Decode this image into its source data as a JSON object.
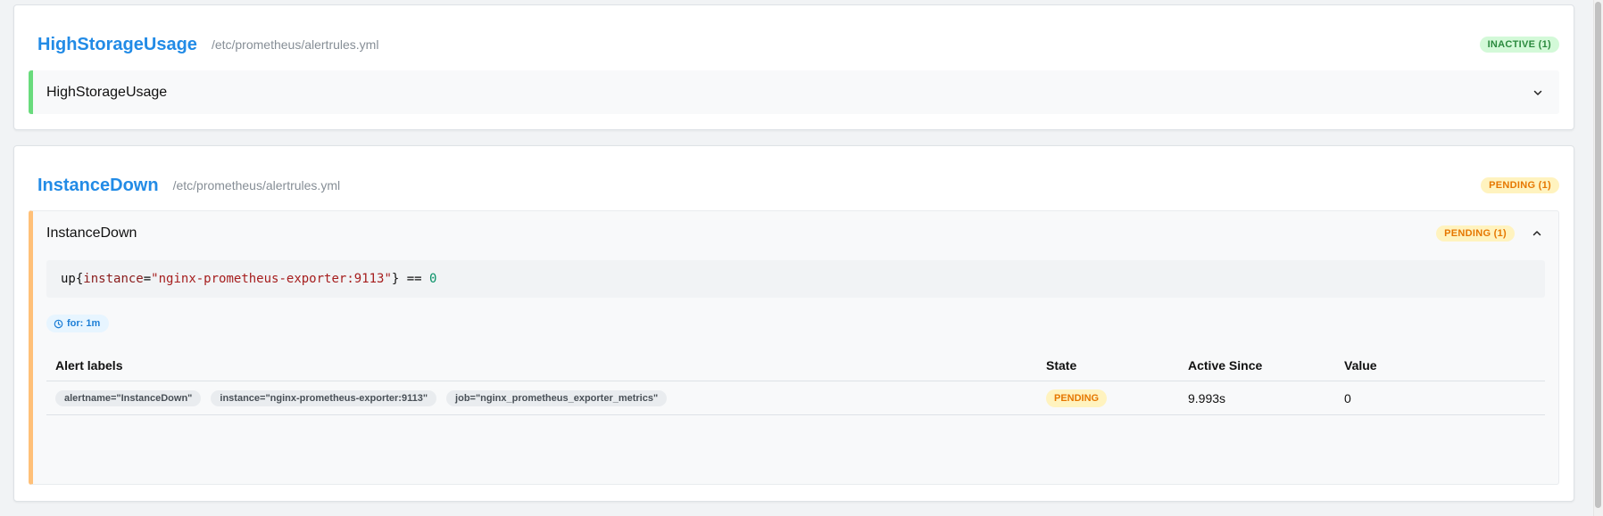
{
  "groups": [
    {
      "title": "HighStorageUsage",
      "file": "/etc/prometheus/alertrules.yml",
      "badge": "INACTIVE (1)",
      "rule_name": "HighStorageUsage"
    },
    {
      "title": "InstanceDown",
      "file": "/etc/prometheus/alertrules.yml",
      "badge": "PENDING (1)",
      "rule_name": "InstanceDown",
      "rule_badge": "PENDING (1)",
      "expr": {
        "metric": "up",
        "open": "{",
        "label": "instance",
        "eq": "=",
        "value": "\"nginx-prometheus-exporter:9113\"",
        "close": "}",
        "op": " == ",
        "num": "0"
      },
      "for_label": "for: 1m",
      "table": {
        "headers": [
          "Alert labels",
          "State",
          "Active Since",
          "Value"
        ],
        "rows": [
          {
            "labels": [
              "alertname=\"InstanceDown\"",
              "instance=\"nginx-prometheus-exporter:9113\"",
              "job=\"nginx_prometheus_exporter_metrics\""
            ],
            "state": "PENDING",
            "active_since": "9.993s",
            "value": "0"
          }
        ]
      }
    }
  ],
  "colors": {
    "title": "#228be6",
    "inactive": "#2b8a3e",
    "pending": "#e67700"
  }
}
